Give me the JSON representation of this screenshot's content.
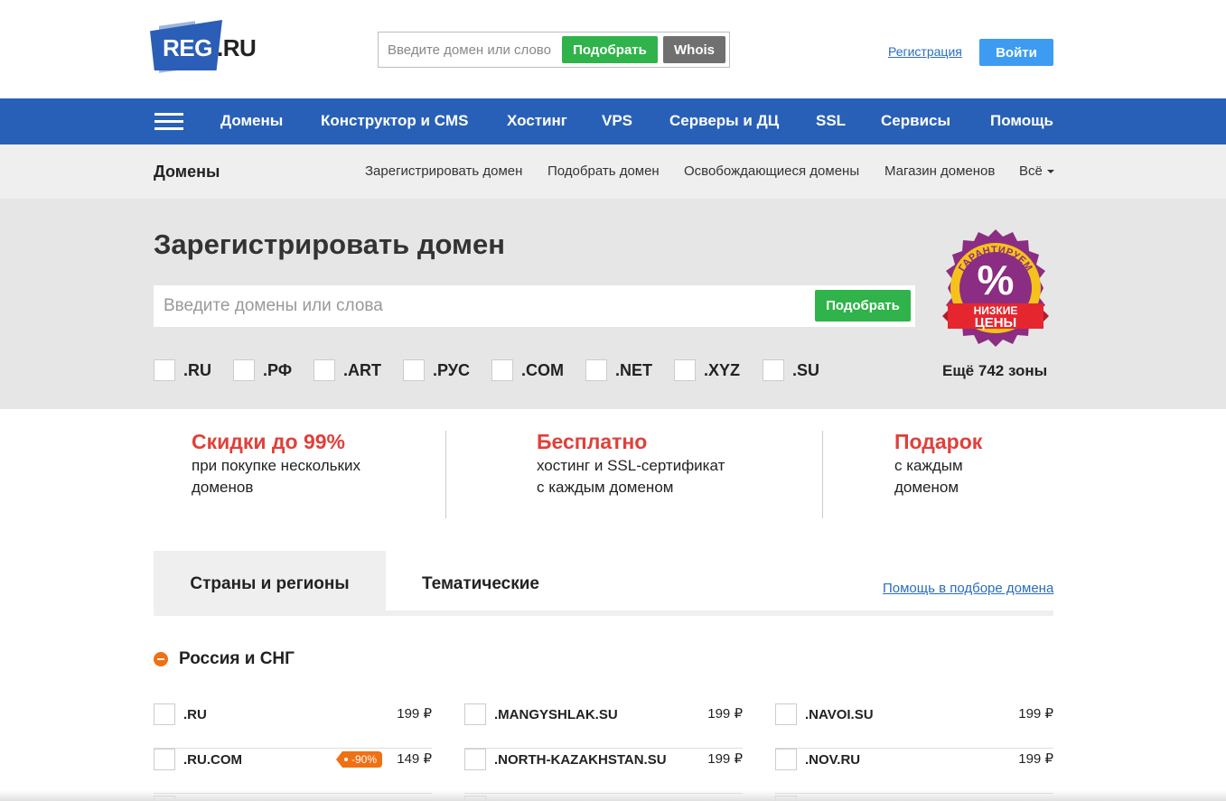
{
  "header": {
    "logo_text_a": "REG",
    "logo_text_b": ".RU",
    "search_placeholder": "Введите домен или слово",
    "search_button": "Подобрать",
    "whois_button": "Whois",
    "register_link": "Регистрация",
    "login_button": "Войти"
  },
  "nav": {
    "items": [
      "Домены",
      "Конструктор и CMS",
      "Хостинг",
      "VPS",
      "Серверы и ДЦ",
      "SSL",
      "Сервисы",
      "Помощь"
    ]
  },
  "subnav": {
    "title": "Домены",
    "links": [
      "Зарегистрировать домен",
      "Подобрать домен",
      "Освобождающиеся домены",
      "Магазин доменов",
      "Всё"
    ]
  },
  "hero": {
    "title": "Зарегистрировать домен",
    "search_placeholder": "Введите домены или слова",
    "search_button": "Подобрать",
    "zones": [
      ".RU",
      ".РФ",
      ".ART",
      ".РУС",
      ".COM",
      ".NET",
      ".XYZ",
      ".SU"
    ],
    "more_zones": "Ещё 742 зоны",
    "badge_top": "ГАРАНТИРУЕМ",
    "badge_symbol": "%",
    "badge_line1": "НИЗКИЕ",
    "badge_line2": "ЦЕНЫ",
    "colors": {
      "badge_purple": "#8b2d82",
      "badge_yellow": "#f5c21b",
      "badge_red": "#e5262f"
    }
  },
  "promos": [
    {
      "title": "Скидки до 99%",
      "line1": "при покупке нескольких",
      "line2": "доменов"
    },
    {
      "title": "Бесплатно",
      "line1": "хостинг и SSL-сертификат",
      "line2": "с каждым доменом"
    },
    {
      "title": "Подарок",
      "line1": "с каждым",
      "line2": "доменом"
    }
  ],
  "tabs": {
    "items": [
      "Страны и регионы",
      "Тематические"
    ],
    "active": "Страны и регионы",
    "help_link": "Помощь в подборе домена"
  },
  "region": {
    "title": "Россия и СНГ",
    "columns": [
      [
        {
          "name": ".RU",
          "price": "199 ₽"
        },
        {
          "name": ".RU.COM",
          "price": "149 ₽",
          "discount": "-90%"
        }
      ],
      [
        {
          "name": ".MANGYSHLAK.SU",
          "price": "199 ₽"
        },
        {
          "name": ".NORTH-KAZAKHSTAN.SU",
          "price": "199 ₽"
        }
      ],
      [
        {
          "name": ".NAVOI.SU",
          "price": "199 ₽"
        },
        {
          "name": ".NOV.RU",
          "price": "199 ₽"
        }
      ]
    ]
  }
}
